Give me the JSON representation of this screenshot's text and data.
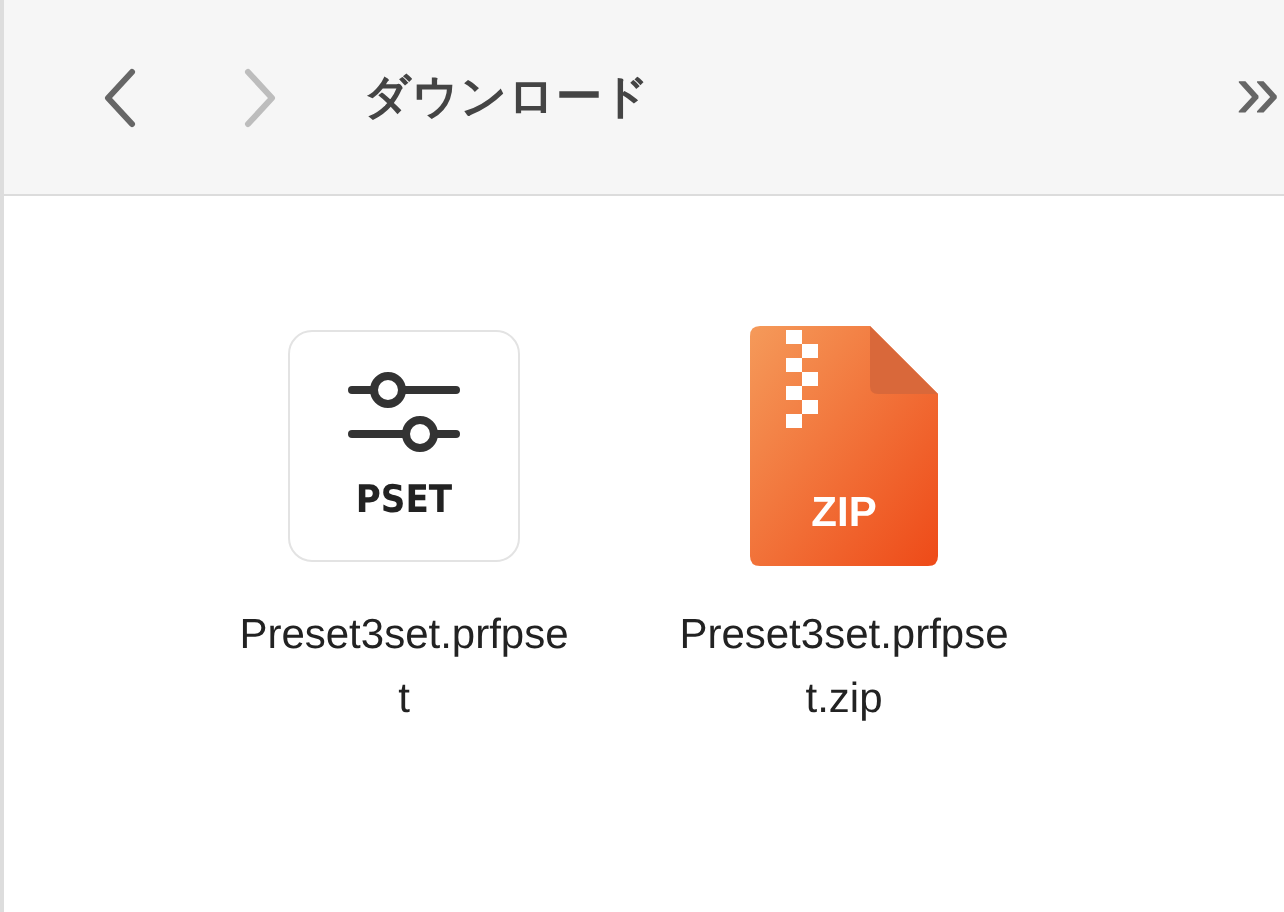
{
  "toolbar": {
    "back": {
      "disabled": false
    },
    "forward": {
      "disabled": true
    },
    "title": "ダウンロード",
    "overflow": "»"
  },
  "files": [
    {
      "kind": "pset",
      "badge": "PSET",
      "name_lines": [
        "Preset3set.prfpse",
        "t"
      ]
    },
    {
      "kind": "zip",
      "badge": "ZIP",
      "name_lines": [
        "Preset3set.prfpse",
        "t.zip"
      ]
    }
  ]
}
